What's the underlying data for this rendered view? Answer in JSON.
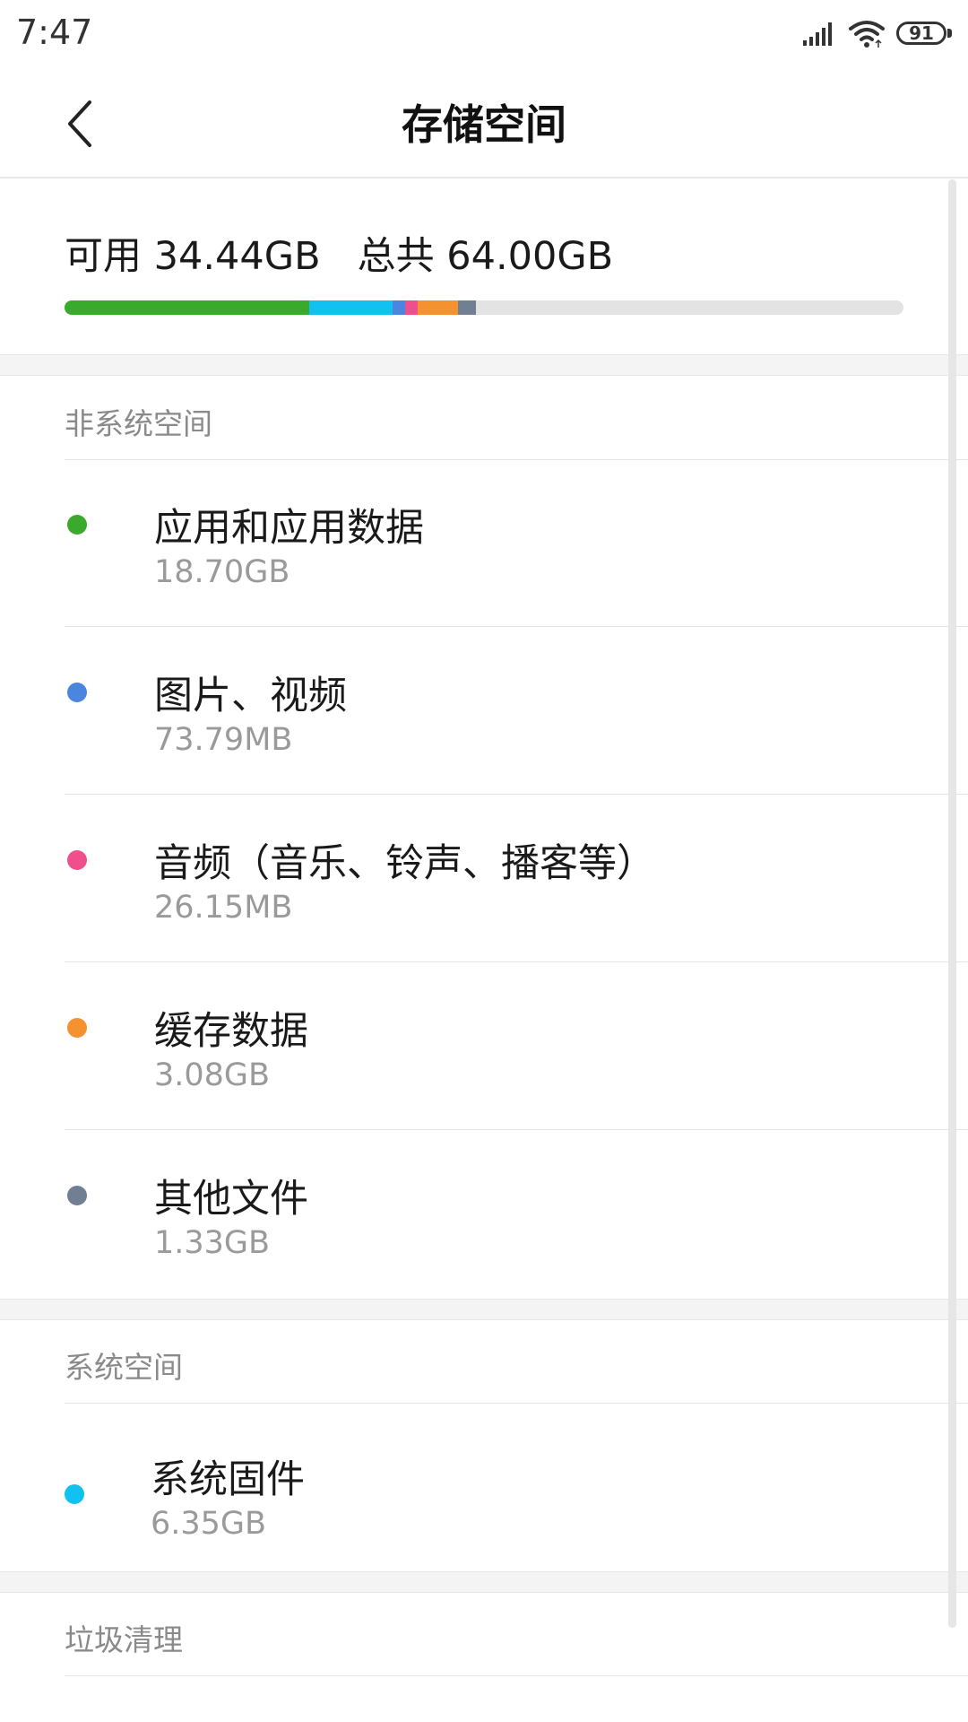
{
  "status_bar": {
    "time": "7:47",
    "battery": "91",
    "icons": [
      "signal-icon",
      "wifi-icon",
      "battery-icon"
    ]
  },
  "header": {
    "title": "存储空间",
    "back_icon": "chevron-left-icon"
  },
  "summary": {
    "text": "可用 34.44GB   总共 64.00GB",
    "usage_segments": [
      {
        "name": "应用和应用数据",
        "color": "#3aaa2c",
        "value_gb": 18.7
      },
      {
        "name": "系统固件",
        "color": "#12c1f0",
        "value_gb": 6.35
      },
      {
        "name": "图片、视频",
        "color": "#4a86e0",
        "value_gb": 0.07379
      },
      {
        "name": "音频（音乐、铃声、播客等）",
        "color": "#f04f8e",
        "value_gb": 0.02615
      },
      {
        "name": "缓存数据",
        "color": "#f3922e",
        "value_gb": 3.08
      },
      {
        "name": "其他文件",
        "color": "#717f92",
        "value_gb": 1.33
      }
    ],
    "total_gb": 64.0
  },
  "non_system": {
    "header": "非系统空间",
    "items": [
      {
        "label": "应用和应用数据",
        "size": "18.70GB",
        "color": "#3aaa2c"
      },
      {
        "label": "图片、视频",
        "size": "73.79MB",
        "color": "#4a86e0"
      },
      {
        "label": "音频（音乐、铃声、播客等）",
        "size": "26.15MB",
        "color": "#f04f8e"
      },
      {
        "label": "缓存数据",
        "size": "3.08GB",
        "color": "#f3922e"
      },
      {
        "label": "其他文件",
        "size": "1.33GB",
        "color": "#717f92"
      }
    ]
  },
  "system": {
    "header": "系统空间",
    "items": [
      {
        "label": "系统固件",
        "size": "6.35GB",
        "color": "#12c1f0"
      }
    ]
  },
  "cleanup": {
    "header": "垃圾清理"
  }
}
